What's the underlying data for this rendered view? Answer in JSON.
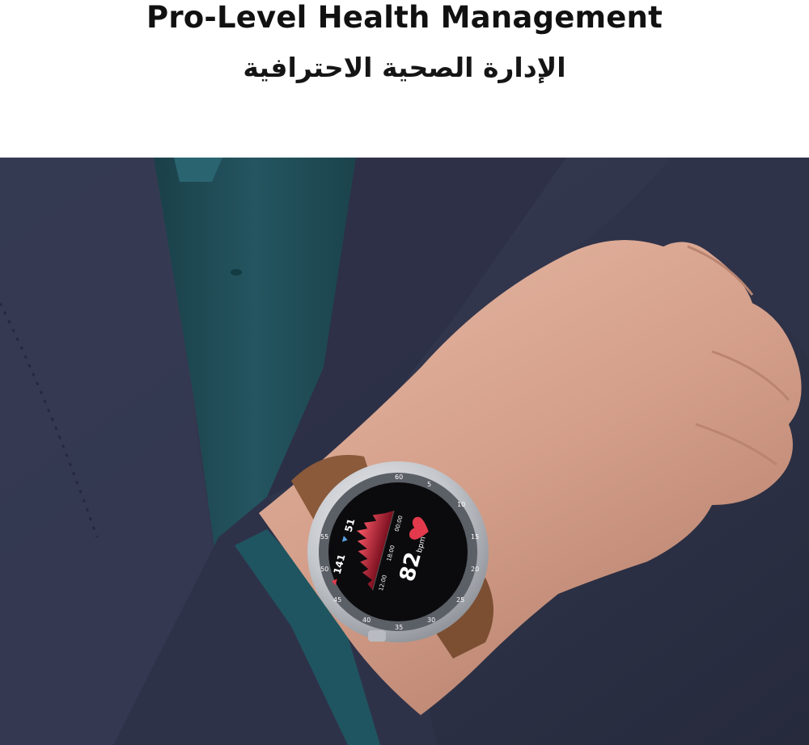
{
  "header": {
    "title_en": "Pro-Level Health Management",
    "title_ar": "الإدارة الصحية الاحترافية"
  },
  "watch": {
    "heart_rate_value": "82",
    "heart_rate_unit": "bpm",
    "max_value": "141",
    "min_value": "51",
    "chart_time_labels": [
      "12:00",
      "18:00",
      "00:00"
    ],
    "bezel_numbers": [
      "55",
      "60",
      "5",
      "10",
      "15",
      "20",
      "25",
      "30",
      "35",
      "40",
      "45",
      "50"
    ]
  },
  "colors": {
    "jacket": "#343850",
    "shirt": "#1f4d57",
    "skin": "#d7a48f",
    "strap": "#8a5a3b",
    "case": "#c9ccd1",
    "screen": "#0b0b0d",
    "chart_red": "#e23a4c"
  },
  "icons": [
    "heart-icon",
    "up-arrow-icon",
    "down-arrow-icon"
  ]
}
